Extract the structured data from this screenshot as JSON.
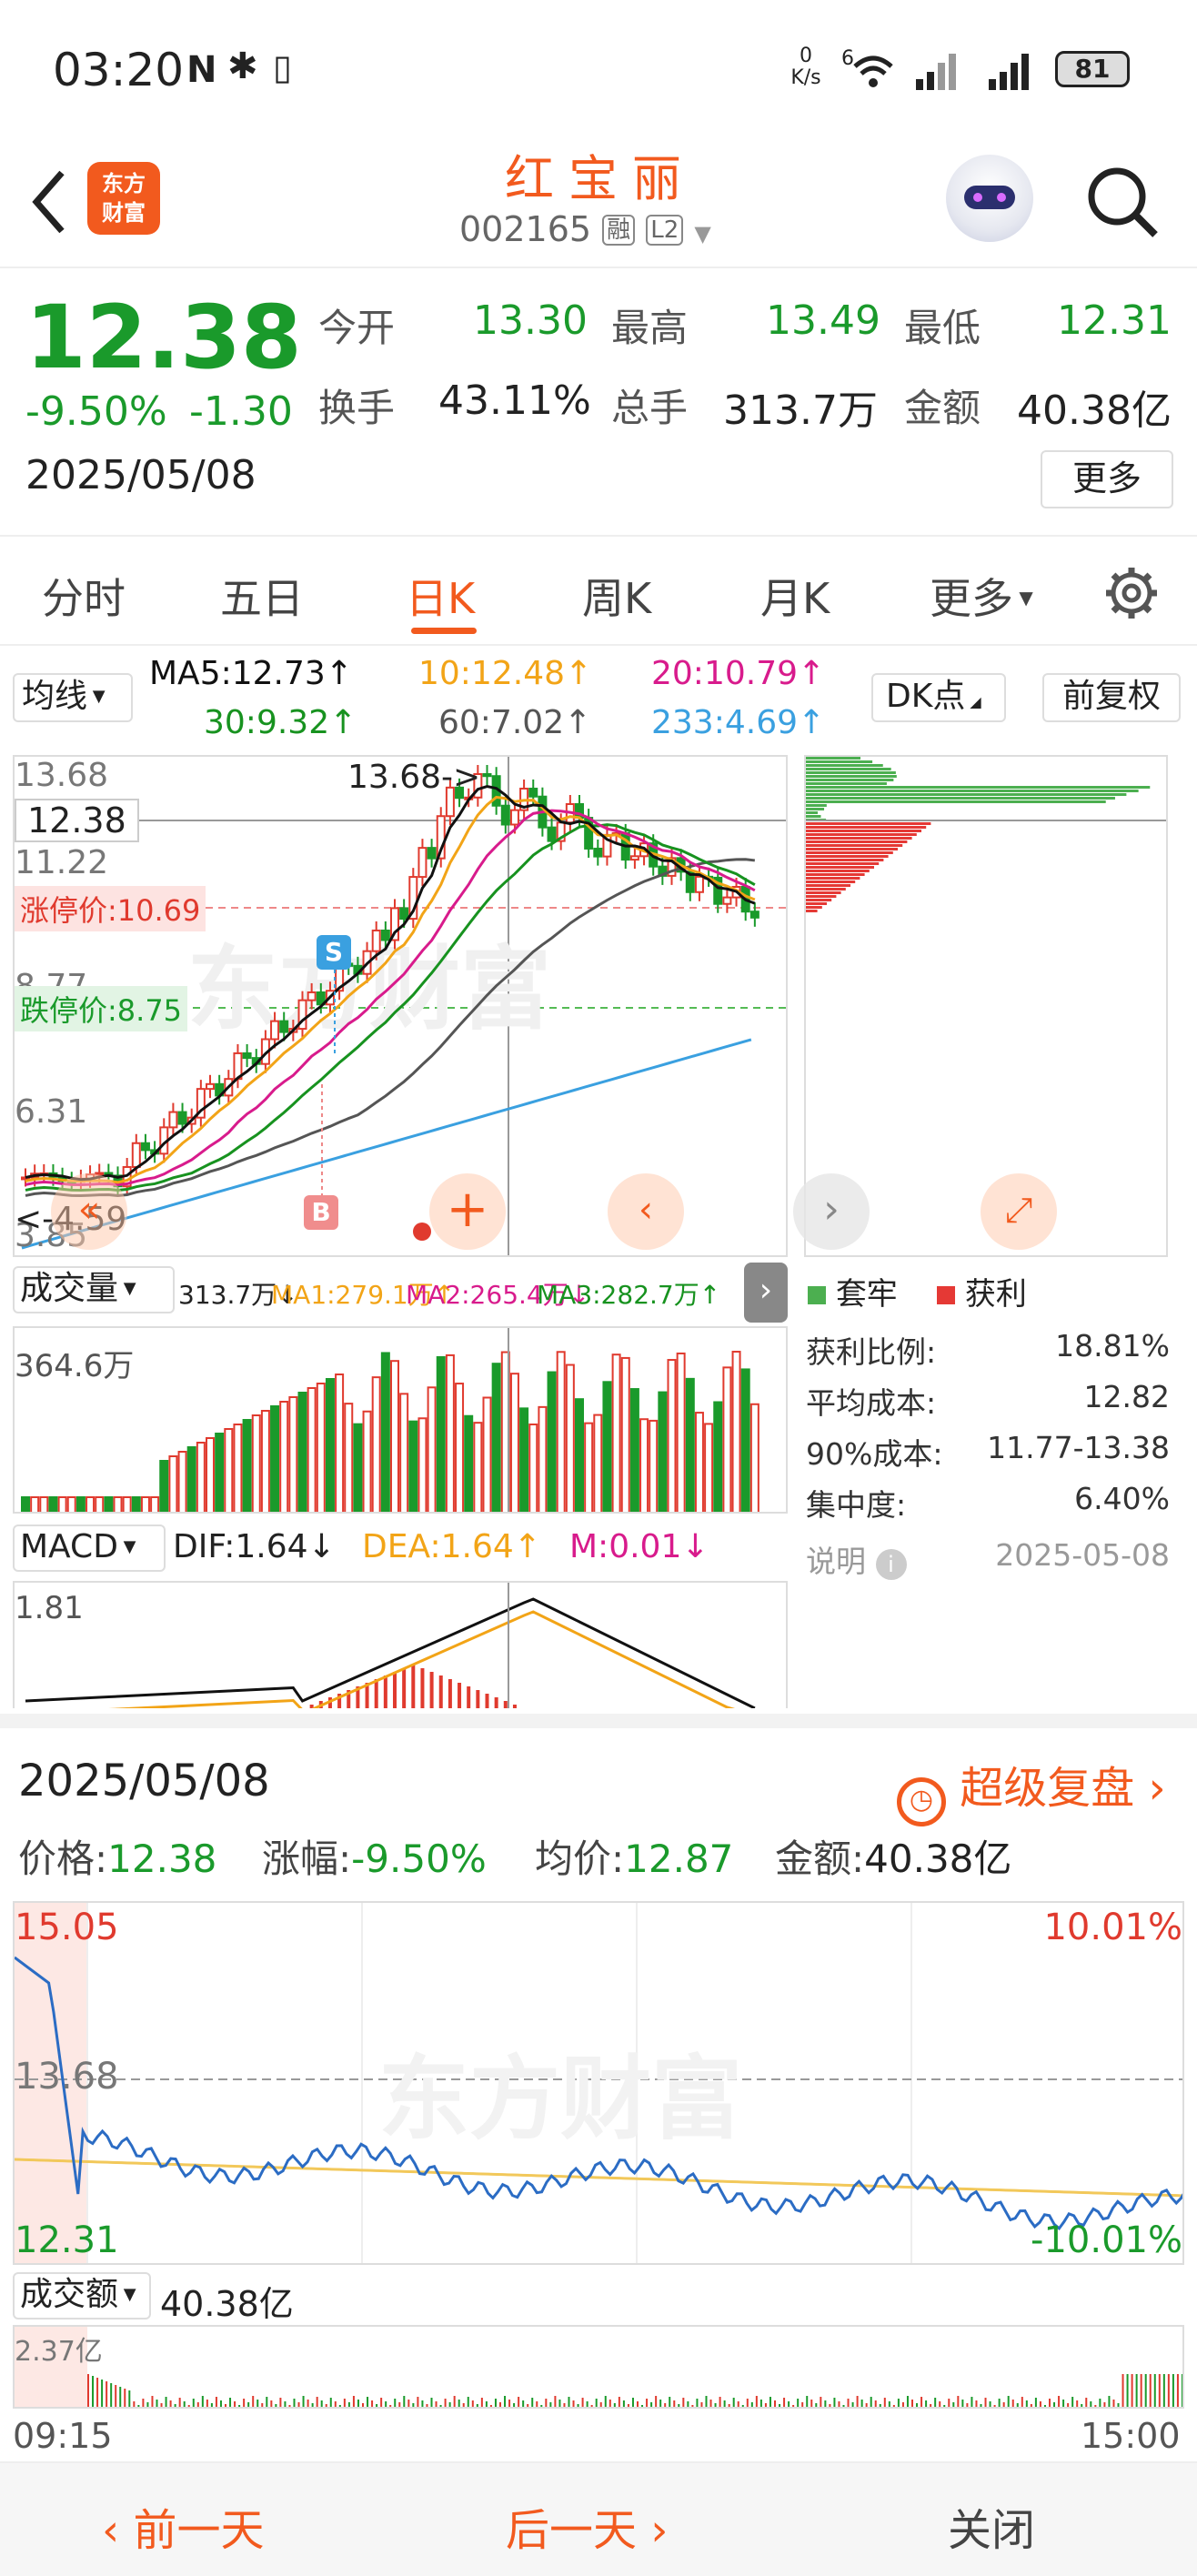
{
  "status_bar": {
    "time": "03:20",
    "net_speed_top": "0",
    "net_speed_unit": "K/s",
    "signal_tag": "6",
    "battery": "81"
  },
  "header": {
    "title": "红宝丽",
    "code": "002165",
    "rong": "融",
    "level": "L2",
    "logo_line1": "东方",
    "logo_line2": "财富"
  },
  "quote": {
    "price": "12.38",
    "change_pct": "-9.50%",
    "change": "-1.30",
    "date": "2025/05/08",
    "open_label": "今开",
    "open": "13.30",
    "high_label": "最高",
    "high": "13.49",
    "low_label": "最低",
    "low": "12.31",
    "turnover_label": "换手",
    "turnover": "43.11%",
    "volume_label": "总手",
    "volume": "313.7万",
    "amount_label": "金额",
    "amount": "40.38亿",
    "more_label": "更多"
  },
  "tabs": [
    "分时",
    "五日",
    "日K",
    "周K",
    "月K",
    "更多"
  ],
  "active_tab": "日K",
  "ma": {
    "selector": "均线",
    "ma5": "MA5:12.73↑",
    "ma10": "10:12.48↑",
    "ma20": "20:10.79↑",
    "ma30": "30:9.32↑",
    "ma60": "60:7.02↑",
    "ma233": "233:4.69↑",
    "dk": "DK点",
    "fuquan": "前复权"
  },
  "kline": {
    "y1": "13.68",
    "y_cur": "12.38",
    "y2": "11.22",
    "limit_up": "涨停价:10.69",
    "y3": "8.77",
    "limit_down": "跌停价:8.75",
    "y4": "6.31",
    "y5": "3.85",
    "high_mark": "13.68->",
    "low_mark": "<-4.59",
    "s_mark": "S",
    "b_mark": "B"
  },
  "chips": {
    "legend_trapped": "套牢",
    "legend_profit": "获利",
    "rows": [
      {
        "label": "获利比例:",
        "value": "18.81%"
      },
      {
        "label": "平均成本:",
        "value": "12.82"
      },
      {
        "label": "90%成本:",
        "value": "11.77-13.38"
      },
      {
        "label": "集中度:",
        "value": "6.40%"
      }
    ],
    "note": "说明",
    "note_date": "2025-05-08"
  },
  "volume": {
    "selector": "成交量",
    "v": "313.7万↓",
    "ma1": "MA1:279.1万↑",
    "ma2": "MA2:265.4万↓",
    "ma3": "MA3:282.7万↑",
    "y_max": "364.6万"
  },
  "macd": {
    "selector": "MACD",
    "dif": "DIF:1.64↓",
    "dea": "DEA:1.64↑",
    "m": "M:0.01↓",
    "y_max": "1.81"
  },
  "intraday": {
    "date": "2025/05/08",
    "replay": "超级复盘",
    "price_label": "价格:",
    "price": "12.38",
    "chg_label": "涨幅:",
    "chg": "-9.50%",
    "avg_label": "均价:",
    "avg": "12.87",
    "amt_label": "金额:",
    "amt": "40.38亿",
    "y_top": "15.05",
    "y_top_pct": "10.01%",
    "y_mid": "13.68",
    "y_low": "12.31",
    "y_low_pct": "-10.01%",
    "vol_selector": "成交额",
    "vol_value": "40.38亿",
    "vol_max": "2.37亿",
    "t_start": "09:15",
    "t_end": "15:00"
  },
  "footer": {
    "prev": "前一天",
    "next": "后一天",
    "close": "关闭"
  },
  "colors": {
    "up": "#e03a2e",
    "down": "#1a9a2b",
    "accent": "#f25a1e",
    "ma5": "#111111",
    "ma10": "#f2a417",
    "ma20": "#d81b8c",
    "ma30": "#17921f",
    "ma60": "#555555",
    "ma233": "#3aa0e0"
  }
}
